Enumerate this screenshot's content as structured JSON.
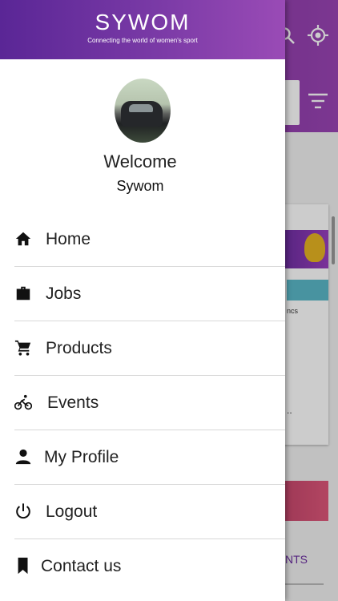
{
  "brand": {
    "name": "SYWOM",
    "tagline": "Connecting the world of women's sport"
  },
  "user": {
    "welcome": "Welcome",
    "name": "Sywom"
  },
  "menu": [
    {
      "label": "Home",
      "icon": "home-icon"
    },
    {
      "label": "Jobs",
      "icon": "briefcase-icon"
    },
    {
      "label": "Products",
      "icon": "cart-icon"
    },
    {
      "label": "Events",
      "icon": "bicycle-icon"
    },
    {
      "label": "My Profile",
      "icon": "person-icon"
    },
    {
      "label": "Logout",
      "icon": "power-icon"
    },
    {
      "label": "Contact us",
      "icon": "bookmark-icon"
    }
  ],
  "background": {
    "card_text": "ncs",
    "tab_text": "NTS",
    "ellipsis": ".."
  },
  "colors": {
    "brand_purple": "#6b2da0",
    "icon": "#111111",
    "divider": "#d8d8d8"
  }
}
